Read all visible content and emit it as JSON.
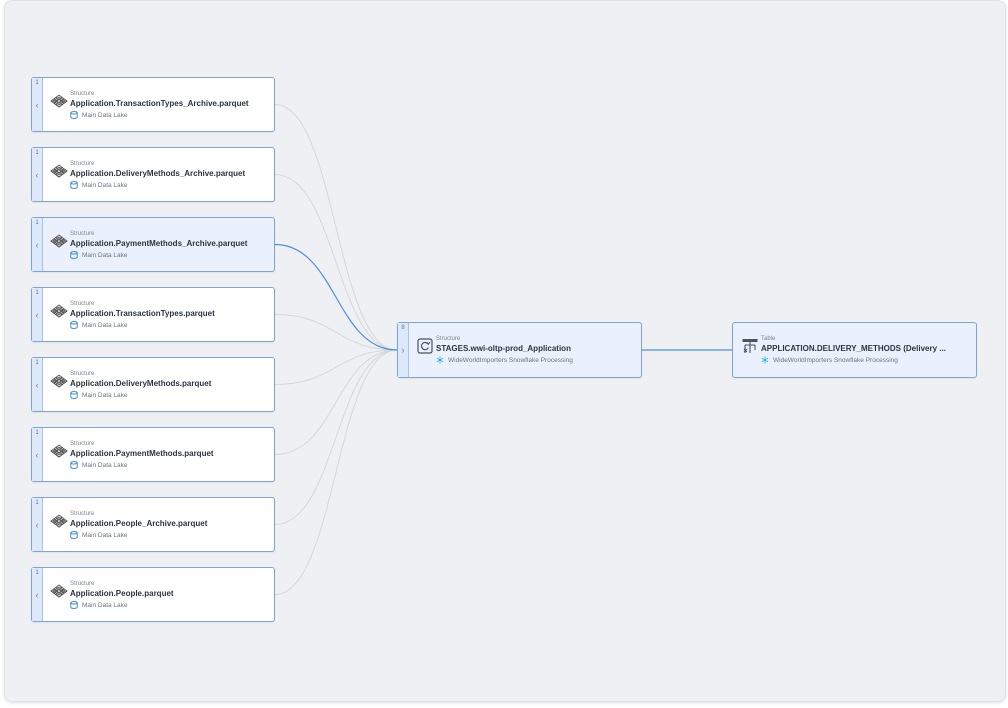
{
  "source_nodes": [
    {
      "count": "1",
      "type": "Structure",
      "name": "Application.TransactionTypes_Archive.parquet",
      "source": "Main Data Lake",
      "icon": "parquet-structure-icon"
    },
    {
      "count": "1",
      "type": "Structure",
      "name": "Application.DeliveryMethods_Archive.parquet",
      "source": "Main Data Lake",
      "icon": "parquet-structure-icon"
    },
    {
      "count": "1",
      "type": "Structure",
      "name": "Application.PaymentMethods_Archive.parquet",
      "source": "Main Data Lake",
      "icon": "parquet-structure-icon"
    },
    {
      "count": "1",
      "type": "Structure",
      "name": "Application.TransactionTypes.parquet",
      "source": "Main Data Lake",
      "icon": "parquet-structure-icon"
    },
    {
      "count": "1",
      "type": "Structure",
      "name": "Application.DeliveryMethods.parquet",
      "source": "Main Data Lake",
      "icon": "parquet-structure-icon"
    },
    {
      "count": "1",
      "type": "Structure",
      "name": "Application.PaymentMethods.parquet",
      "source": "Main Data Lake",
      "icon": "parquet-structure-icon"
    },
    {
      "count": "1",
      "type": "Structure",
      "name": "Application.People_Archive.parquet",
      "source": "Main Data Lake",
      "icon": "parquet-structure-icon"
    },
    {
      "count": "1",
      "type": "Structure",
      "name": "Application.People.parquet",
      "source": "Main Data Lake",
      "icon": "parquet-structure-icon"
    }
  ],
  "middle_node": {
    "count": "8",
    "type": "Structure",
    "name": "STAGES.wwi-oltp-prod_Application",
    "source": "WideWorldImporters Snowflake Processing",
    "icon": "refresh-structure-icon"
  },
  "target_node": {
    "type": "Table",
    "name": "APPLICATION.DELIVERY_METHODS (Delivery ...",
    "source": "WideWorldImporters Snowflake Processing",
    "icon": "table-icon"
  },
  "colors": {
    "highlight_edge": "#4a90e2",
    "edge": "#d4d7dc",
    "node_border": "#7da4dc",
    "snowflake": "#29b5e8",
    "datalake": "#2f7fd0"
  }
}
